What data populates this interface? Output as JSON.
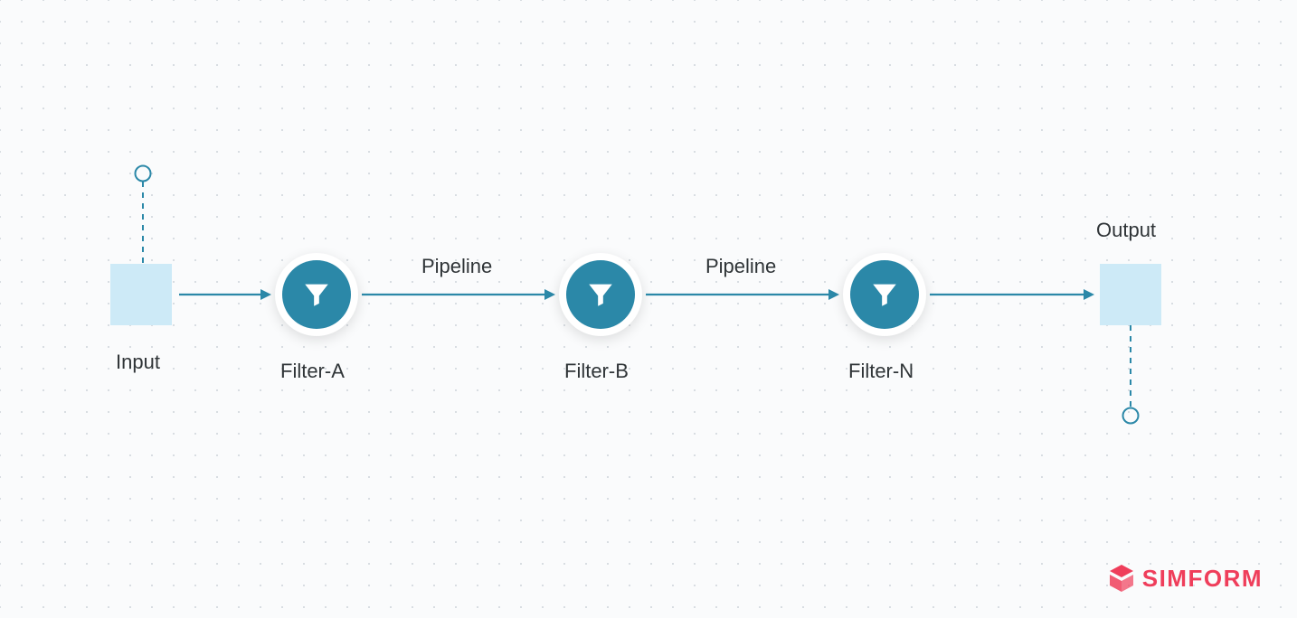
{
  "diagram": {
    "input_label": "Input",
    "output_label": "Output",
    "filters": [
      {
        "label": "Filter-A"
      },
      {
        "label": "Filter-B"
      },
      {
        "label": "Filter-N"
      }
    ],
    "pipeline_labels": [
      "Pipeline",
      "Pipeline"
    ]
  },
  "brand": {
    "name": "SIMFORM"
  },
  "colors": {
    "node_fill": "#2b88a8",
    "box_fill": "#cdeaf7",
    "arrow": "#2b88a8",
    "brand": "#ef3e5b"
  }
}
